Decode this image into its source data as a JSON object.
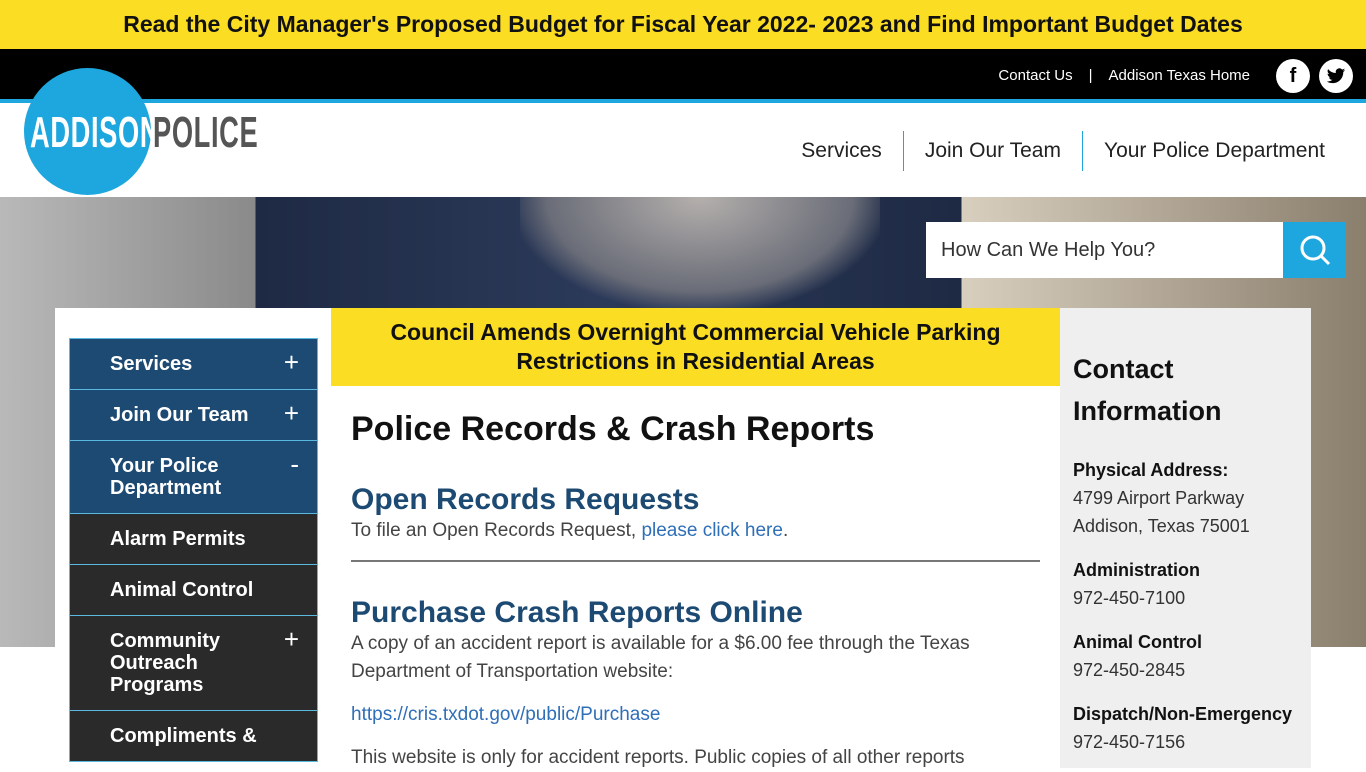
{
  "alert": {
    "text": "Read the City Manager's Proposed Budget for Fiscal Year 2022- 2023 and Find Important Budget Dates"
  },
  "topbar": {
    "contact": "Contact Us",
    "sep": "|",
    "home": "Addison Texas Home",
    "facebook": "f",
    "twitter": "t"
  },
  "logo": {
    "left": "ADDISON",
    "right": "POLICE",
    "brand_color": "#1ea7df"
  },
  "nav": [
    "Services",
    "Join Our Team",
    "Your Police Department"
  ],
  "search": {
    "placeholder": "How Can We Help You?"
  },
  "sidebar": [
    {
      "label": "Services",
      "toggle": "+"
    },
    {
      "label": "Join Our Team",
      "toggle": "+"
    },
    {
      "label": "Your Police Department",
      "toggle": "-"
    },
    {
      "label": "Alarm Permits"
    },
    {
      "label": "Animal Control"
    },
    {
      "label": "Community Outreach Programs",
      "toggle": "+"
    },
    {
      "label": "Compliments &"
    }
  ],
  "news": {
    "text": "Council Amends Overnight Commercial Vehicle Parking Restrictions in Residential Areas"
  },
  "main": {
    "title": "Police Records & Crash Reports",
    "s1_title": "Open Records Requests",
    "s1_text": "To file an Open Records Request, ",
    "s1_link": "please click here",
    "s1_end": ".",
    "s2_title": "Purchase Crash Reports Online",
    "s2_text": "A copy of an accident report is available for a $6.00 fee through the Texas Department of Transportation website:",
    "s2_link": "https://cris.txdot.gov/public/Purchase",
    "s2_more": "This website is only for accident reports.  Public copies of all other reports"
  },
  "contact": {
    "title": "Contact Information",
    "addr_label": "Physical Address:",
    "addr1": "4799 Airport Parkway",
    "addr2": "Addison, Texas 75001",
    "admin_label": "Administration",
    "admin": "972-450-7100",
    "animal_label": "Animal Control",
    "animal": "972-450-2845",
    "dispatch_label": "Dispatch/Non-Emergency",
    "dispatch": "972-450-7156"
  }
}
